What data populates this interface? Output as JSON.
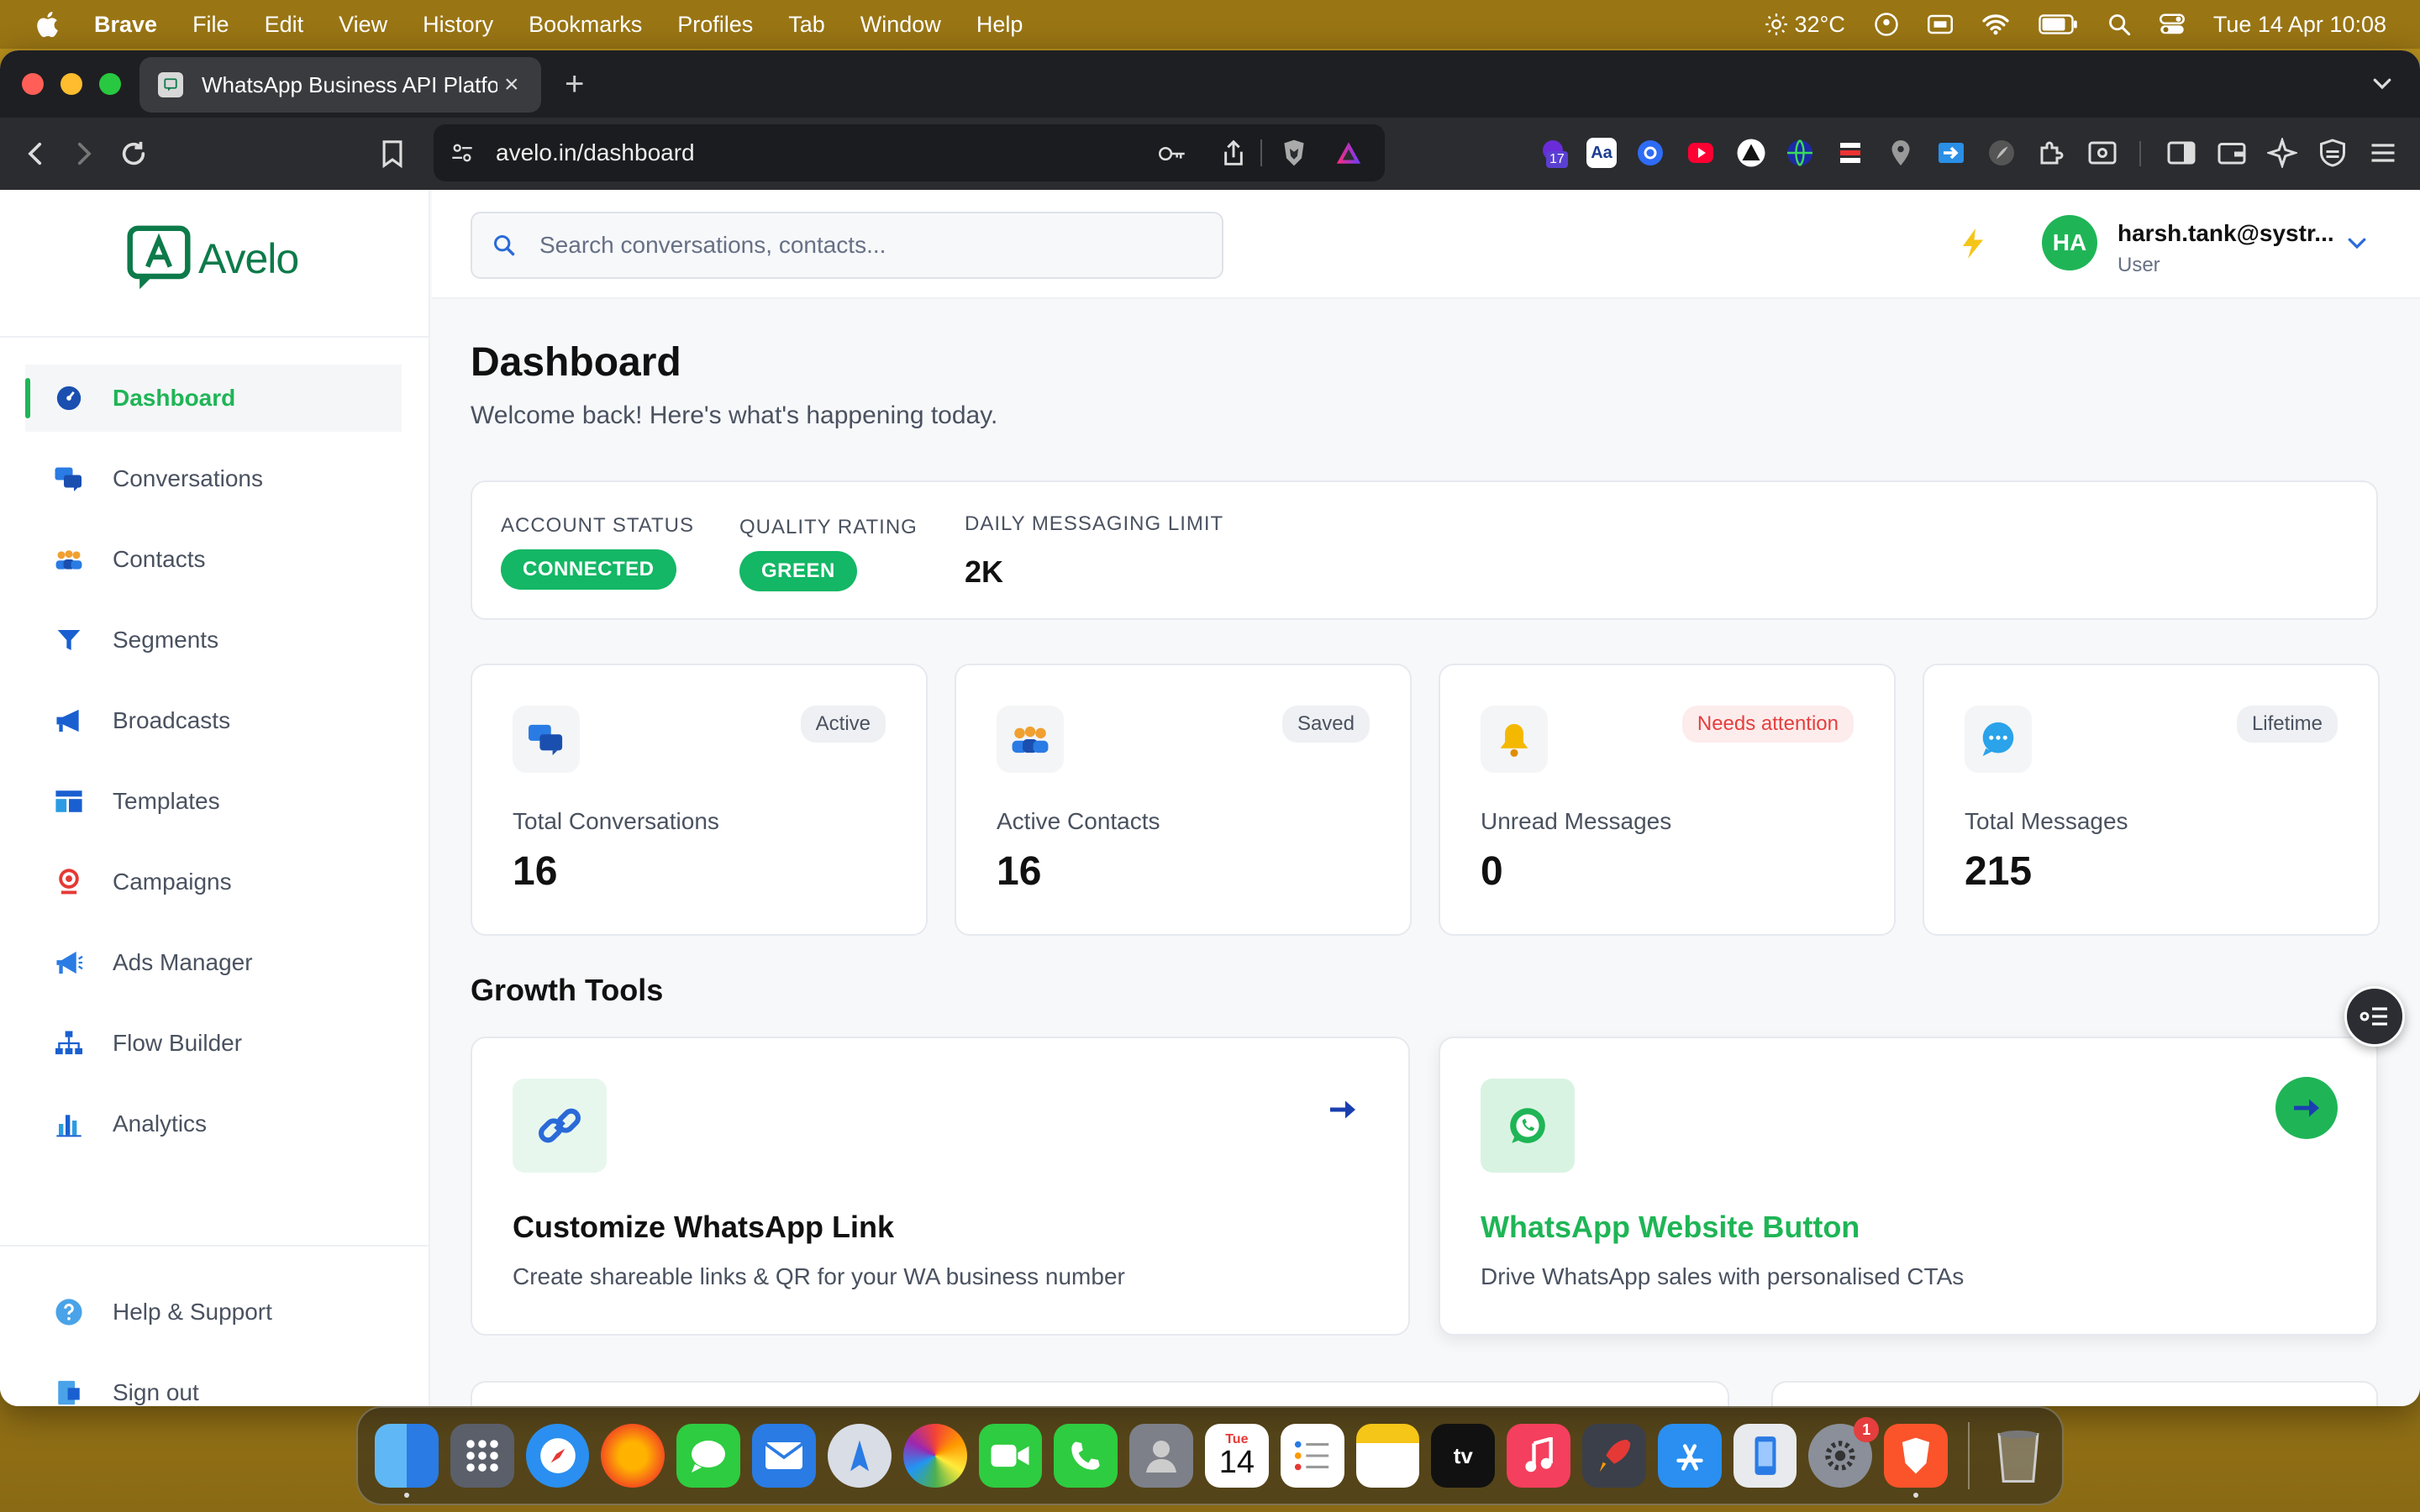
{
  "menubar": {
    "app_name": "Brave",
    "items": [
      "File",
      "Edit",
      "View",
      "History",
      "Bookmarks",
      "Profiles",
      "Tab",
      "Window",
      "Help"
    ],
    "temperature": "32°C",
    "datetime": "Tue 14 Apr  10:08"
  },
  "browser": {
    "tab_title": "WhatsApp Business API Platform",
    "url": "avelo.in/dashboard",
    "extension_badge": "17"
  },
  "sidebar": {
    "logo_text": "Avelo",
    "items": [
      {
        "label": "Dashboard",
        "icon": "dashboard-icon"
      },
      {
        "label": "Conversations",
        "icon": "chat-bubbles-icon"
      },
      {
        "label": "Contacts",
        "icon": "people-icon"
      },
      {
        "label": "Segments",
        "icon": "funnel-icon"
      },
      {
        "label": "Broadcasts",
        "icon": "megaphone-icon"
      },
      {
        "label": "Templates",
        "icon": "template-icon"
      },
      {
        "label": "Campaigns",
        "icon": "target-icon"
      },
      {
        "label": "Ads Manager",
        "icon": "bullhorn-icon"
      },
      {
        "label": "Flow Builder",
        "icon": "sitemap-icon"
      },
      {
        "label": "Analytics",
        "icon": "bar-chart-icon"
      }
    ],
    "footer": [
      {
        "label": "Help & Support",
        "icon": "question-icon"
      },
      {
        "label": "Sign out",
        "icon": "sign-out-icon"
      }
    ]
  },
  "header": {
    "search_placeholder": "Search conversations, contacts...",
    "avatar_initials": "HA",
    "user_name": "harsh.tank@systr...",
    "user_role": "User"
  },
  "dashboard": {
    "title": "Dashboard",
    "subtitle": "Welcome back! Here's what's happening today.",
    "status": {
      "account_status_label": "ACCOUNT STATUS",
      "account_status_value": "CONNECTED",
      "quality_label": "QUALITY RATING",
      "quality_value": "GREEN",
      "limit_label": "DAILY MESSAGING LIMIT",
      "limit_value": "2K"
    },
    "stats": [
      {
        "badge": "Active",
        "label": "Total Conversations",
        "value": "16"
      },
      {
        "badge": "Saved",
        "label": "Active Contacts",
        "value": "16"
      },
      {
        "badge": "Needs attention",
        "label": "Unread Messages",
        "value": "0"
      },
      {
        "badge": "Lifetime",
        "label": "Total Messages",
        "value": "215"
      }
    ],
    "growth_title": "Growth Tools",
    "tools": [
      {
        "title": "Customize WhatsApp Link",
        "desc": "Create shareable links & QR for your WA business number"
      },
      {
        "title": "WhatsApp Website Button",
        "desc": "Drive WhatsApp sales with personalised CTAs"
      }
    ]
  },
  "dock": {
    "calendar_month": "Tue",
    "calendar_day": "14",
    "tv_label": "tv",
    "settings_badge": "1"
  },
  "colors": {
    "brand_green": "#1fb556",
    "status_green": "#13b765",
    "attention_red": "#e53e3e"
  }
}
